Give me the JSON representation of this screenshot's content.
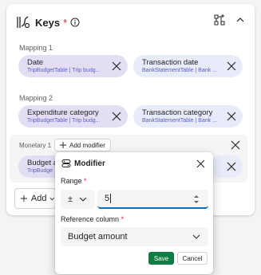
{
  "header": {
    "title": "Keys",
    "required_mark": "*",
    "icons": [
      "keys-icon",
      "info-icon",
      "add-key-icon",
      "chevron-up-icon"
    ]
  },
  "mapping1": {
    "label": "Mapping 1",
    "left": {
      "name": "Date",
      "source": "TripBudgetTable | Trip budg..."
    },
    "right": {
      "name": "Transaction date",
      "source": "BankStatementTable | Bank ..."
    }
  },
  "mapping2": {
    "label": "Mapping 2",
    "left": {
      "name": "Expenditure category",
      "source": "TripBudgetTable | Trip budg..."
    },
    "right": {
      "name": "Transaction category",
      "source": "BankStatementTable | Bank ..."
    }
  },
  "monetary": {
    "label": "Monetary 1",
    "add_modifier": "Add modifier",
    "left": {
      "name": "Budget a",
      "source": "TripBudge"
    }
  },
  "add_button": {
    "label": "Add"
  },
  "modifier": {
    "title": "Modifier",
    "range_label": "Range",
    "required_mark": "*",
    "sign_value": "±",
    "range_value": "5",
    "reference_label": "Reference column",
    "reference_value": "Budget amount",
    "save": "Save",
    "cancel": "Cancel"
  },
  "colors": {
    "accent": "#0f6cbd",
    "save": "#107c41",
    "pill_left": "#e4def5",
    "pill_right": "#e8ebfa",
    "required": "#c4314b",
    "source_text": "#5b5fc7"
  }
}
